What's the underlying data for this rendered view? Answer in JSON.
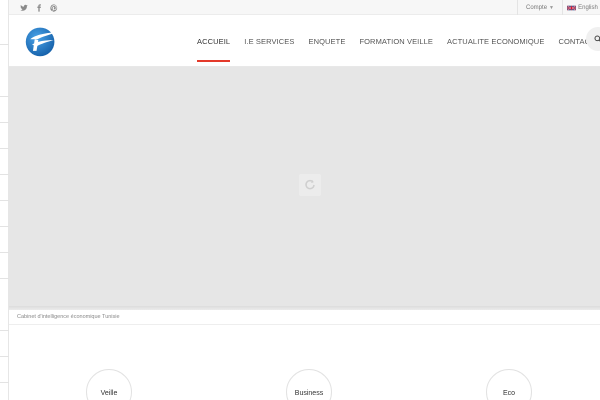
{
  "topbar": {
    "social": [
      {
        "icon": "twitter-icon"
      },
      {
        "icon": "facebook-icon"
      },
      {
        "icon": "pinterest-icon"
      }
    ],
    "account_label": "Compte",
    "language_label": "English"
  },
  "header": {
    "logo_icon": "company-logo",
    "nav": [
      {
        "label": "ACCUEIL",
        "active": true
      },
      {
        "label": "I.E SERVICES"
      },
      {
        "label": "ENQUETE"
      },
      {
        "label": "FORMATION VEILLE"
      },
      {
        "label": "ACTUALITE ECONOMIQUE"
      },
      {
        "label": "CONTACT"
      }
    ],
    "search_icon": "search-icon"
  },
  "slider": {
    "loader_icon": "loading-icon"
  },
  "caption": "Cabinet d'intelligence économique Tunisie",
  "features": [
    {
      "label": "Veille"
    },
    {
      "label": "Business"
    },
    {
      "label": "Eco"
    }
  ],
  "colors": {
    "accent": "#e43a2b",
    "logo_blue": "#1e78c8",
    "slider_bg": "#e6e6e6"
  }
}
